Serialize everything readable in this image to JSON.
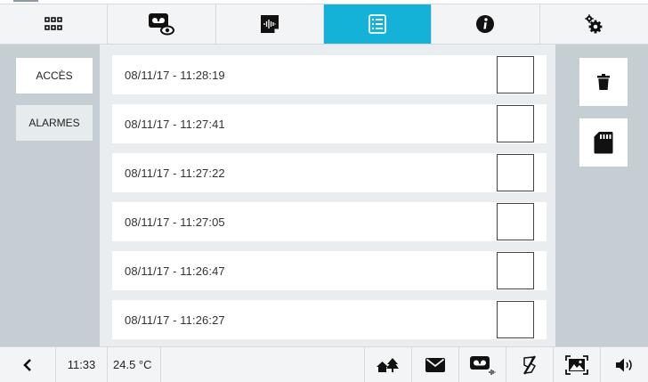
{
  "top_tabs": [
    {
      "icon": "apps-grid-icon",
      "active": false
    },
    {
      "icon": "video-message-icon",
      "active": false
    },
    {
      "icon": "audio-message-icon",
      "active": false
    },
    {
      "icon": "event-list-icon",
      "active": true
    },
    {
      "icon": "info-icon",
      "active": false
    },
    {
      "icon": "settings-gears-icon",
      "active": false
    }
  ],
  "sidebar": {
    "items": [
      {
        "label": "ACCÈS",
        "selected": false
      },
      {
        "label": "ALARMES",
        "selected": true
      }
    ]
  },
  "events": {
    "rows": [
      {
        "time": "08/11/17 - 11:28:19",
        "checked": false
      },
      {
        "time": "08/11/17 - 11:27:41",
        "checked": false
      },
      {
        "time": "08/11/17 - 11:27:22",
        "checked": false
      },
      {
        "time": "08/11/17 - 11:27:05",
        "checked": false
      },
      {
        "time": "08/11/17 - 11:26:47",
        "checked": false
      },
      {
        "time": "08/11/17 - 11:26:27",
        "checked": false
      }
    ]
  },
  "actions": {
    "delete_icon": "trash-icon",
    "sd_icon": "sd-card-icon"
  },
  "status_bar": {
    "clock": "11:33",
    "temperature": "24.5 °C",
    "icons": [
      "home-away-icon",
      "envelope-icon",
      "video-memo-icon",
      "do-not-disturb-icon",
      "picture-icon",
      "speaker-icon"
    ]
  },
  "colors": {
    "accent": "#13b2d6",
    "panel": "#c5ced3",
    "list_bg": "#e9edf0"
  }
}
